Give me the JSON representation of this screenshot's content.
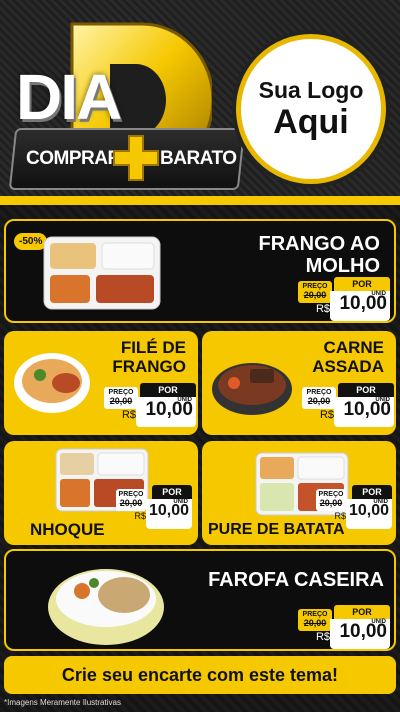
{
  "header": {
    "big_letter": "D",
    "word_dia": "DIA",
    "ribbon_left": "COMPRAR",
    "ribbon_right": "BARATO",
    "logo_line1": "Sua Logo",
    "logo_line2": "Aqui"
  },
  "colors": {
    "accent": "#f5c800",
    "dark": "#0d0d0d"
  },
  "products": [
    {
      "name_line1": "FRANGO AO",
      "name_line2": "MOLHO",
      "badge": "-50%",
      "por": "POR",
      "preco": "PREÇO",
      "old": "20,00",
      "currency": "R$",
      "price": "10,00",
      "unit": "UNID"
    },
    {
      "name_line1": "FILÉ DE",
      "name_line2": "FRANGO",
      "por": "POR",
      "preco": "PREÇO",
      "old": "20,00",
      "currency": "R$",
      "price": "10,00",
      "unit": "UNID"
    },
    {
      "name_line1": "CARNE",
      "name_line2": "ASSADA",
      "por": "POR",
      "preco": "PREÇO",
      "old": "20,00",
      "currency": "R$",
      "price": "10,00",
      "unit": "UNID"
    },
    {
      "name_line1": "NHOQUE",
      "por": "POR",
      "preco": "PREÇO",
      "old": "20,00",
      "currency": "R$",
      "price": "10,00",
      "unit": "UNID"
    },
    {
      "name_line1": "PURE DE BATATA",
      "por": "POR",
      "preco": "PREÇO",
      "old": "20,00",
      "currency": "R$",
      "price": "10,00",
      "unit": "UNID"
    },
    {
      "name_line1": "FAROFA CASEIRA",
      "por": "POR",
      "preco": "PREÇO",
      "old": "20,00",
      "currency": "R$",
      "price": "10,00",
      "unit": "UNID"
    }
  ],
  "footer": {
    "cta": "Crie seu encarte com este tema!",
    "disclaimer": "*Imagens Meramente Ilustrativas"
  }
}
